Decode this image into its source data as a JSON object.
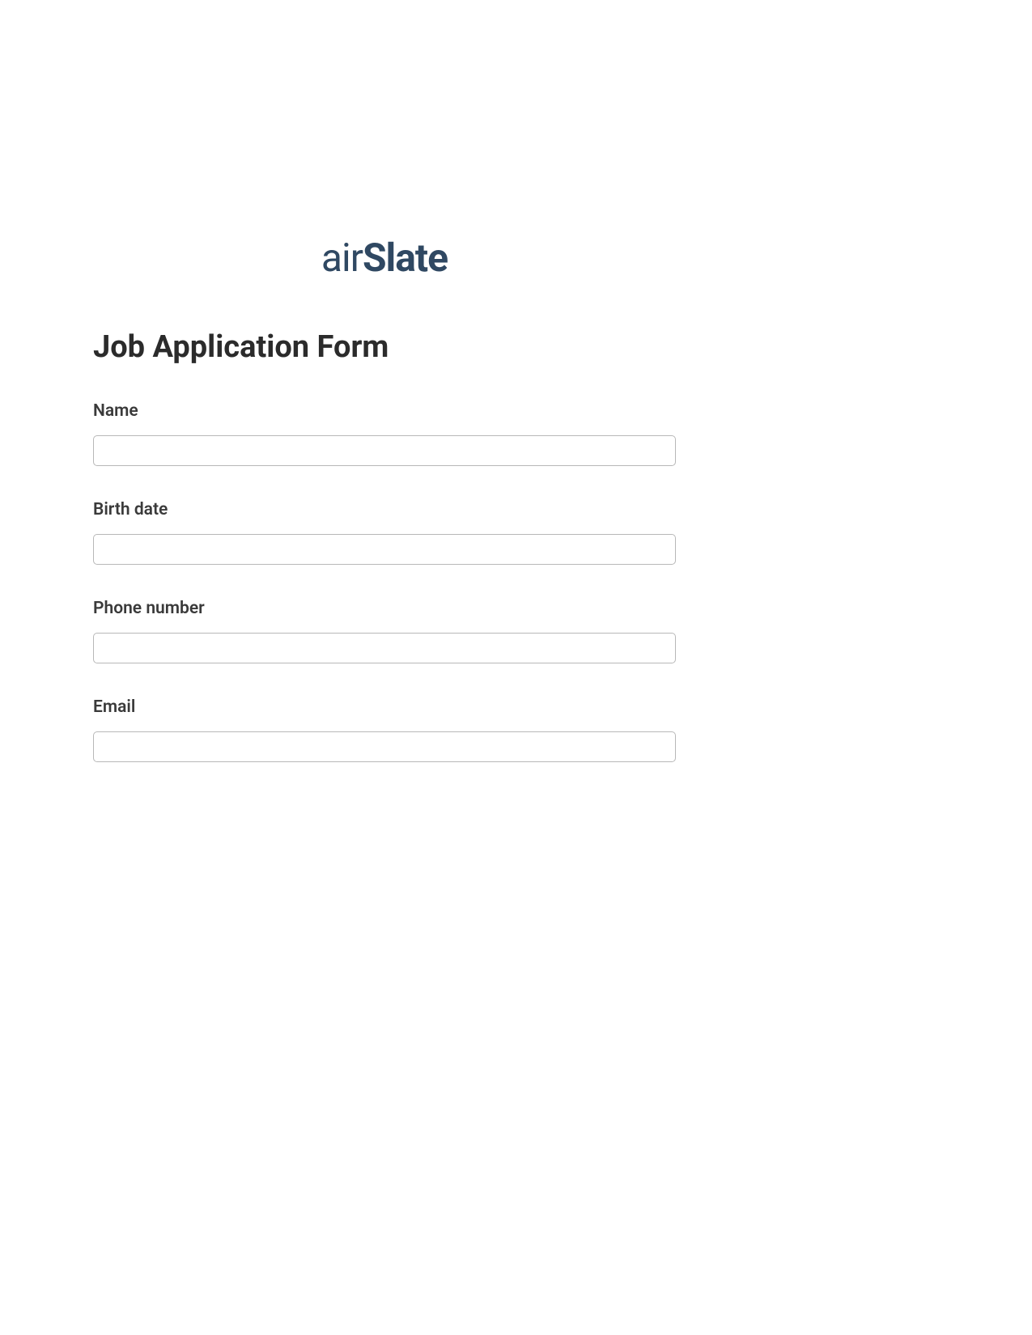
{
  "logo": {
    "part1": "air",
    "part2": "Slate"
  },
  "form": {
    "title": "Job Application Form",
    "fields": [
      {
        "label": "Name",
        "value": ""
      },
      {
        "label": "Birth date",
        "value": ""
      },
      {
        "label": "Phone number",
        "value": ""
      },
      {
        "label": "Email",
        "value": ""
      }
    ]
  }
}
